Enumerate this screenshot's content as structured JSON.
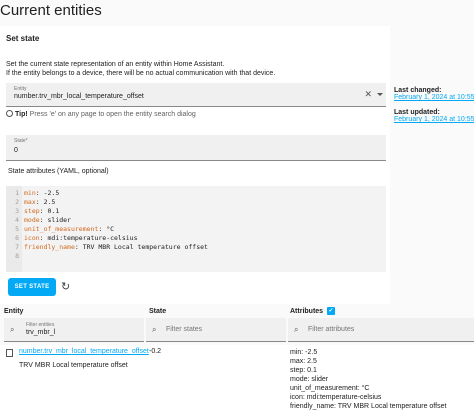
{
  "page": {
    "title": "Current entities"
  },
  "set_state": {
    "header": "Set state",
    "description_1": "Set the current state representation of an entity within Home Assistant.",
    "description_2": "If the entity belongs to a device, there will be no actual communication with that device.",
    "entity_label": "Entity",
    "entity_value": "number.trv_mbr_local_temperature_offset",
    "tip_bold": "Tip!",
    "tip_text": " Press 'e' on any page to open the entity search dialog",
    "state_label": "State*",
    "state_value": "0",
    "attributes_label": "State attributes (YAML, optional)",
    "button": "SET STATE"
  },
  "yaml_lines": [
    {
      "n": "1",
      "k": "min",
      "v": " -2.5"
    },
    {
      "n": "2",
      "k": "max",
      "v": " 2.5"
    },
    {
      "n": "3",
      "k": "step",
      "v": " 0.1"
    },
    {
      "n": "4",
      "k": "mode",
      "v": " slider"
    },
    {
      "n": "5",
      "k": "unit_of_measurement",
      "v": " °C"
    },
    {
      "n": "6",
      "k": "icon",
      "v": " mdi:temperature-celsius"
    },
    {
      "n": "7",
      "k": "friendly_name",
      "v": " TRV MBR Local temperature offset"
    },
    {
      "n": "8",
      "k": "",
      "v": ""
    }
  ],
  "sidebar": {
    "last_changed_label": "Last changed:",
    "last_changed_value": "February 1, 2024 at 10:55:21",
    "last_updated_label": "Last updated:",
    "last_updated_value": "February 1, 2024 at 10:55:21"
  },
  "table": {
    "col_entity": "Entity",
    "col_state": "State",
    "col_attributes": "Attributes",
    "filter_entities_label": "Filter entities",
    "filter_entities_value": "trv_mbr_l",
    "filter_states_placeholder": "Filter states",
    "filter_attributes_placeholder": "Filter attributes",
    "row": {
      "entity_id": "number.trv_mbr_local_temperature_offset",
      "friendly_name": "TRV MBR Local temperature offset",
      "state": "-0.2",
      "attributes": [
        "min: -2.5",
        "max: 2.5",
        "step: 0.1",
        "mode: slider",
        "unit_of_measurement: °C",
        "icon: mdi:temperature-celsius",
        "friendly_name: TRV MBR Local temperature offset"
      ]
    }
  },
  "colors": {
    "accent": "#03a9f4",
    "yaml_key": "#d2691e"
  },
  "icons": [
    "close-icon",
    "chevron-down-icon",
    "lightbulb-icon",
    "refresh-icon",
    "search-icon",
    "copy-icon",
    "checkbox-checked-icon"
  ]
}
